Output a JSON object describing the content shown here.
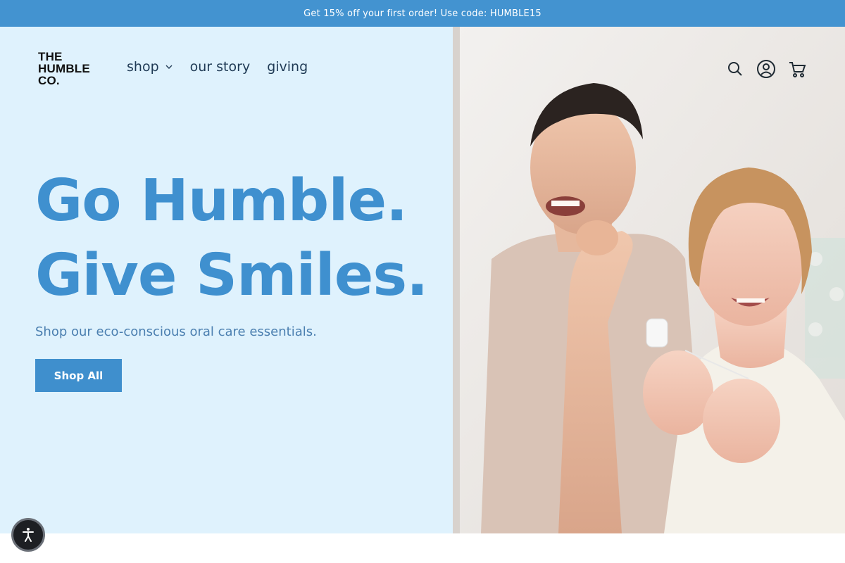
{
  "announcement": {
    "text": "Get 15% off your first order! Use code: HUMBLE15"
  },
  "brand": {
    "logo_lines": [
      "THE",
      "HUMBLE",
      "CO."
    ]
  },
  "nav": {
    "items": [
      {
        "label": "shop",
        "has_dropdown": true
      },
      {
        "label": "our story",
        "has_dropdown": false
      },
      {
        "label": "giving",
        "has_dropdown": false
      }
    ]
  },
  "header_icons": [
    "search-icon",
    "account-icon",
    "cart-icon"
  ],
  "hero": {
    "headline_line1": "Go Humble.",
    "headline_line2": "Give Smiles.",
    "subtext": "Shop our eco-conscious oral care essentials.",
    "cta_label": "Shop All",
    "image_alt": "couple-flossing-at-mirror"
  },
  "accessibility": {
    "icon": "accessibility-icon"
  },
  "colors": {
    "announcement_bg": "#4393d0",
    "hero_bg": "#dff2fd",
    "headline": "#3f90cf",
    "cta_bg": "#3f8fcd"
  }
}
